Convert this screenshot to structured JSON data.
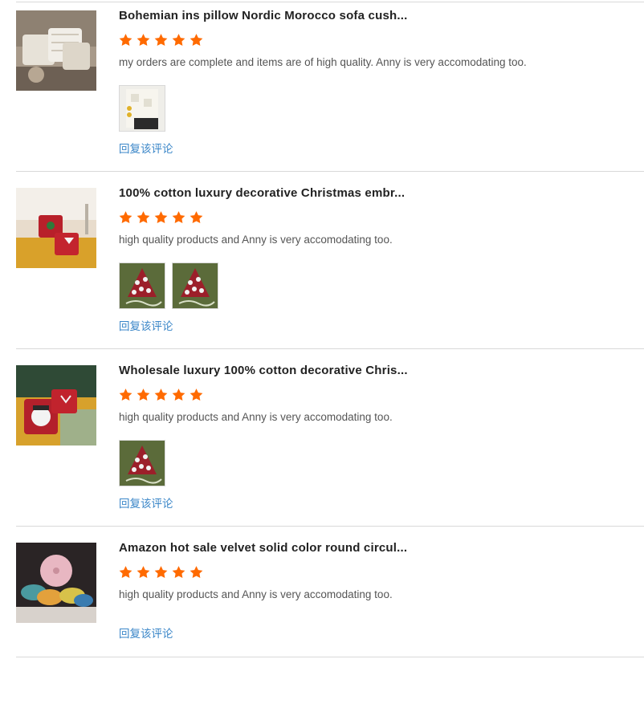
{
  "reviews": [
    {
      "title": "Bohemian ins pillow Nordic Morocco sofa cush...",
      "rating": 5,
      "comment": "my orders are complete and items are of high quality. Anny is very accomodating too.",
      "thumbnail_icon": "boho-pillow-product-image",
      "photos": [
        "boho-pillow-photo"
      ],
      "reply_label": "回复该评论"
    },
    {
      "title": "100% cotton luxury decorative Christmas embr...",
      "rating": 5,
      "comment": "high quality products and Anny is very accomodating too.",
      "thumbnail_icon": "christmas-pillow-product-image",
      "photos": [
        "christmas-tree-pillow-photo",
        "christmas-tree-pillow-photo"
      ],
      "reply_label": "回复该评论"
    },
    {
      "title": "Wholesale luxury 100% cotton decorative Chris...",
      "rating": 5,
      "comment": "high quality products and Anny is very accomodating too.",
      "thumbnail_icon": "snowman-pillow-product-image",
      "photos": [
        "christmas-tree-pillow-photo"
      ],
      "reply_label": "回复该评论"
    },
    {
      "title": "Amazon hot sale velvet solid color round circul...",
      "rating": 5,
      "comment": "high quality products and Anny is very accomodating too.",
      "thumbnail_icon": "round-velvet-cushion-product-image",
      "photos": [],
      "reply_label": "回复该评论"
    }
  ],
  "colors": {
    "star": "#ff6a00",
    "reply_link": "#3a86c8",
    "divider": "#d9d9d9",
    "title": "#222222",
    "comment": "#555555"
  }
}
